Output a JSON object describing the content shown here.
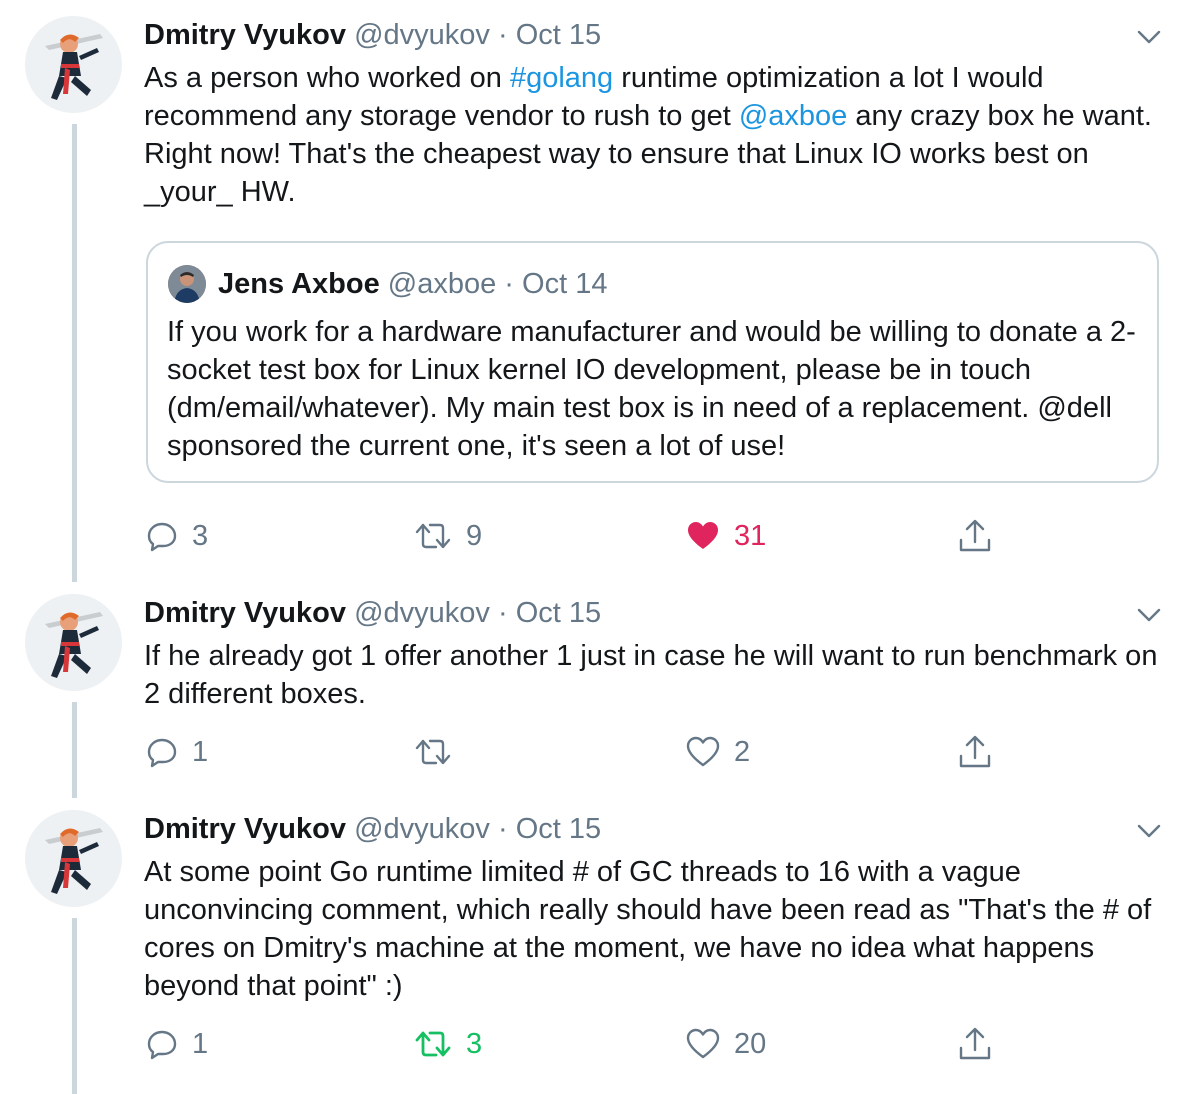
{
  "tweets": [
    {
      "author": {
        "name": "Dmitry Vyukov",
        "handle": "@dvyukov"
      },
      "separator": "·",
      "date": "Oct 15",
      "text": {
        "part1": "As a person who worked on ",
        "hashtag": "#golang",
        "part2": " runtime optimization a lot I would recommend any storage vendor to rush to get ",
        "mention": "@axboe",
        "part3": " any crazy box he want. Right now! That's the cheapest way to ensure that Linux IO works best on _your_ HW."
      },
      "quoted": {
        "author": {
          "name": "Jens Axboe",
          "handle": "@axboe"
        },
        "separator": "·",
        "date": "Oct 14",
        "text": "If you work for a hardware manufacturer and would be willing to donate a 2-socket test box for Linux kernel IO development, please be in touch (dm/email/whatever). My main test box is in need of a replacement. @dell sponsored the current one, it's seen a lot of use!"
      },
      "actions": {
        "replies": "3",
        "retweets": "9",
        "likes": "31",
        "liked": true,
        "retweeted": false
      }
    },
    {
      "author": {
        "name": "Dmitry Vyukov",
        "handle": "@dvyukov"
      },
      "separator": "·",
      "date": "Oct 15",
      "text": "If he already got 1 offer another 1 just in case he will want to run benchmark on 2 different boxes.",
      "actions": {
        "replies": "1",
        "retweets": "",
        "likes": "2",
        "liked": false,
        "retweeted": false
      }
    },
    {
      "author": {
        "name": "Dmitry Vyukov",
        "handle": "@dvyukov"
      },
      "separator": "·",
      "date": "Oct 15",
      "text": "At some point Go runtime limited # of GC threads to 16 with a vague unconvincing comment, which really should have been read as \"That's the # of cores on Dmitry's machine at the moment, we have no idea what happens beyond that point\" :)",
      "actions": {
        "replies": "1",
        "retweets": "3",
        "likes": "20",
        "liked": false,
        "retweeted": true
      }
    }
  ],
  "colors": {
    "link": "#1b95e0",
    "like": "#e0245e",
    "retweet": "#17bf63",
    "muted": "#657786",
    "thread_line": "#ccd6dd"
  },
  "icons": [
    "reply-icon",
    "retweet-icon",
    "like-icon",
    "share-icon",
    "chevron-down-icon"
  ]
}
